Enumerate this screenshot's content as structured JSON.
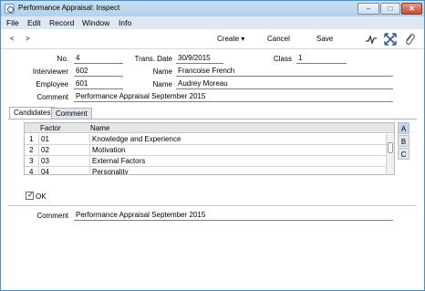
{
  "window": {
    "title": "Performance Appraisal: Inspect",
    "buttons": {
      "minimize": "–",
      "maximize": "□",
      "close": "✕"
    }
  },
  "menubar": {
    "items": [
      "File",
      "Edit",
      "Record",
      "Window",
      "Info"
    ]
  },
  "toolbar": {
    "prev": "<",
    "next": ">",
    "create": "Create",
    "create_arrow": "▾",
    "cancel": "Cancel",
    "save": "Save"
  },
  "form": {
    "no_label": "No.",
    "no_value": "4",
    "trans_date_label": "Trans. Date",
    "trans_date_value": "30/9/2015",
    "class_label": "Class",
    "class_value": "1",
    "interviewer_label": "Interviewer",
    "interviewer_value": "602",
    "interviewer_name_label": "Name",
    "interviewer_name_value": "Francoise French",
    "employee_label": "Employee",
    "employee_value": "601",
    "employee_name_label": "Name",
    "employee_name_value": "Audrey Moreau",
    "comment_label": "Comment",
    "comment_value": "Performance Appraisal September 2015"
  },
  "tabs": [
    "Candidates",
    "Comment"
  ],
  "grid": {
    "headers": [
      "Factor",
      "Name"
    ],
    "rows": [
      {
        "num": "1",
        "factor": "01",
        "name": "Knowledge and Experience"
      },
      {
        "num": "2",
        "factor": "02",
        "name": "Motivation"
      },
      {
        "num": "3",
        "factor": "03",
        "name": "External Factors"
      },
      {
        "num": "4",
        "factor": "04",
        "name": "Personality"
      }
    ]
  },
  "side_buttons": [
    "A",
    "B",
    "C"
  ],
  "ok_checkbox": {
    "label": "OK",
    "checked": true
  },
  "footer": {
    "comment_label": "Comment",
    "comment_value": "Performance Appraisal September 2015"
  }
}
